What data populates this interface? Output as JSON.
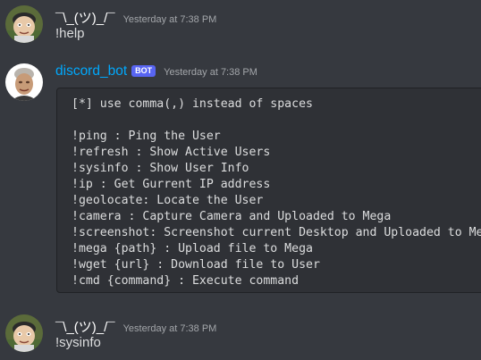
{
  "messages": [
    {
      "author": "¯\\_(ツ)_/¯",
      "timestamp": "Yesterday at 7:38 PM",
      "text": "!help"
    },
    {
      "author": "discord_bot",
      "badge": "BOT",
      "timestamp": "Yesterday at 7:38 PM",
      "code_lines": [
        "[*] use comma(,) instead of spaces",
        "",
        "!ping : Ping the User",
        "!refresh : Show Active Users",
        "!sysinfo : Show User Info",
        "!ip : Get Gurrent IP address",
        "!geolocate: Locate the User",
        "!camera : Capture Camera and Uploaded to Mega",
        "!screenshot: Screenshot current Desktop and Uploaded to Mega",
        "!mega {path} : Upload file to Mega",
        "!wget {url} : Download file to User",
        "!cmd {command} : Execute command"
      ]
    },
    {
      "author": "¯\\_(ツ)_/¯",
      "timestamp": "Yesterday at 7:38 PM",
      "text": "!sysinfo"
    }
  ],
  "colors": {
    "background": "#36393f",
    "code_background": "#2f3136",
    "bot_name": "#00a8fc",
    "bot_badge": "#5865f2",
    "timestamp": "#a3a6aa",
    "text": "#dcddde"
  },
  "icons": {
    "user_avatar": "cartoon-face-avatar-icon",
    "bot_avatar": "bot-avatar-icon"
  }
}
